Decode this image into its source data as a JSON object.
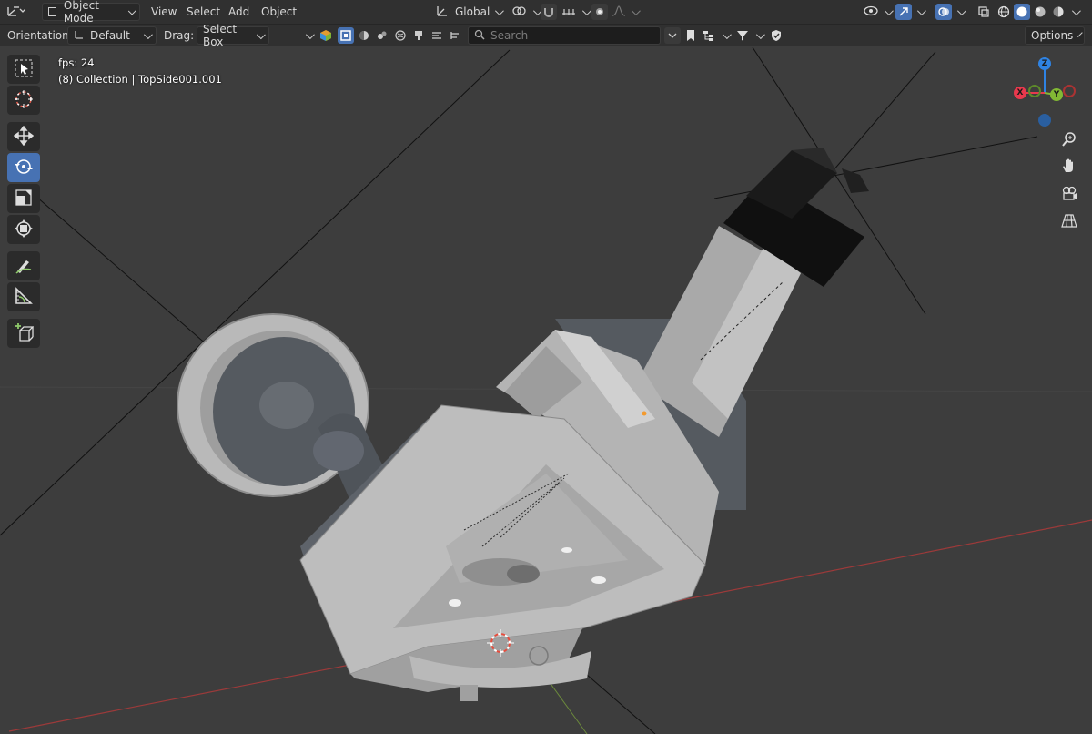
{
  "header": {
    "mode_label": "Object Mode",
    "menus": [
      "View",
      "Select",
      "Add",
      "Object"
    ],
    "transform_orientation": "Global",
    "options_label": "Options"
  },
  "toolbar": {
    "orientation_label": "Orientation:",
    "orientation_value": "Default",
    "drag_label": "Drag:",
    "drag_value": "Select Box",
    "search_placeholder": "Search"
  },
  "viewport": {
    "fps_text": "fps: 24",
    "collection_text": "(8) Collection | TopSide001.001"
  },
  "gizmo": {
    "z_label": "Z",
    "x_label": "X",
    "y_label": "Y",
    "colors": {
      "x": "#e8394d",
      "y": "#82b934",
      "z": "#2f83e3"
    }
  },
  "tools": [
    "select-box",
    "cursor",
    "move",
    "rotate",
    "scale",
    "transform",
    "annotate",
    "measure",
    "add-cube"
  ],
  "active_tool": "rotate",
  "colors": {
    "header_bg": "#303030",
    "viewport_bg": "#3d3d3d",
    "accent": "#4772b3"
  }
}
